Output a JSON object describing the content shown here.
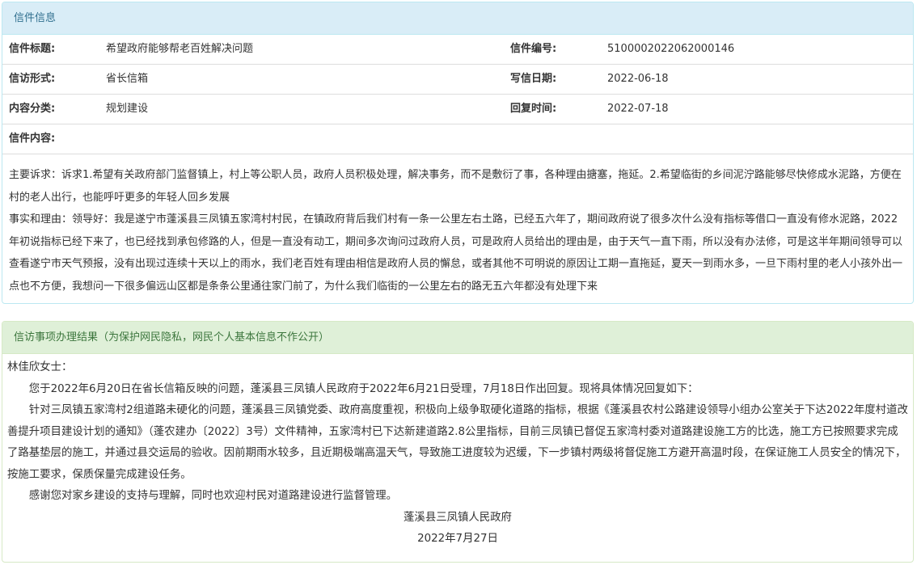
{
  "letter_panel": {
    "heading": "信件信息",
    "rows": [
      {
        "label1": "信件标题:",
        "value1": "希望政府能够帮老百姓解决问题",
        "label2": "信件编号:",
        "value2": "5100002022062000146"
      },
      {
        "label1": "信访形式:",
        "value1": "省长信箱",
        "label2": "写信日期:",
        "value2": "2022-06-18"
      },
      {
        "label1": "内容分类:",
        "value1": "规划建设",
        "label2": "回复时间:",
        "value2": "2022-07-18"
      }
    ],
    "content_label": "信件内容:",
    "content_paragraphs": [
      "主要诉求：诉求1.希望有关政府部门监督镇上，村上等公职人员，政府人员积极处理，解决事务，而不是敷衍了事，各种理由搪塞，拖延。2.希望临街的乡间泥泞路能够尽快修成水泥路，方便在村的老人出行，也能呼吁更多的年轻人回乡发展",
      "事实和理由：领导好：我是遂宁市蓬溪县三凤镇五家湾村村民，在镇政府背后我们村有一条一公里左右土路，已经五六年了，期间政府说了很多次什么没有指标等借口一直没有修水泥路，2022年初说指标已经下来了，也已经找到承包修路的人，但是一直没有动工，期间多次询问过政府人员，可是政府人员给出的理由是，由于天气一直下雨，所以没有办法修，可是这半年期间领导可以查看遂宁市天气预报，没有出现过连续十天以上的雨水，我们老百姓有理由相信是政府人员的懈怠，或者其他不可明说的原因让工期一直拖延，夏天一到雨水多，一旦下雨村里的老人小孩外出一点也不方便，我想问一下很多偏远山区都是条条公里通往家门前了，为什么我们临街的一公里左右的路无五六年都没有处理下来"
    ]
  },
  "result_panel": {
    "heading": "信访事项办理结果（为保护网民隐私，网民个人基本信息不作公开）",
    "salutation": "林佳欣女士：",
    "paragraphs": [
      "您于2022年6月20日在省长信箱反映的问题，蓬溪县三凤镇人民政府于2022年6月21日受理，7月18日作出回复。现将具体情况回复如下：",
      "针对三凤镇五家湾村2组道路未硬化的问题，蓬溪县三凤镇党委、政府高度重视，积极向上级争取硬化道路的指标，根据《蓬溪县农村公路建设领导小组办公室关于下达2022年度村道改善提升项目建设计划的通知》（蓬农建办〔2022〕3号）文件精神，五家湾村已下达新建道路2.8公里指标，目前三凤镇已督促五家湾村委对道路建设施工方的比选，施工方已按照要求完成了路基垫层的施工，并通过县交运局的验收。因前期雨水较多，且近期极端高温天气，导致施工进度较为迟缓，下一步镇村两级将督促施工方避开高温时段，在保证施工人员安全的情况下，按施工要求，保质保量完成建设任务。",
      "感谢您对家乡建设的支持与理解，同时也欢迎村民对道路建设进行监督管理。"
    ],
    "signature": "蓬溪县三凤镇人民政府",
    "date": "2022年7月27日"
  }
}
